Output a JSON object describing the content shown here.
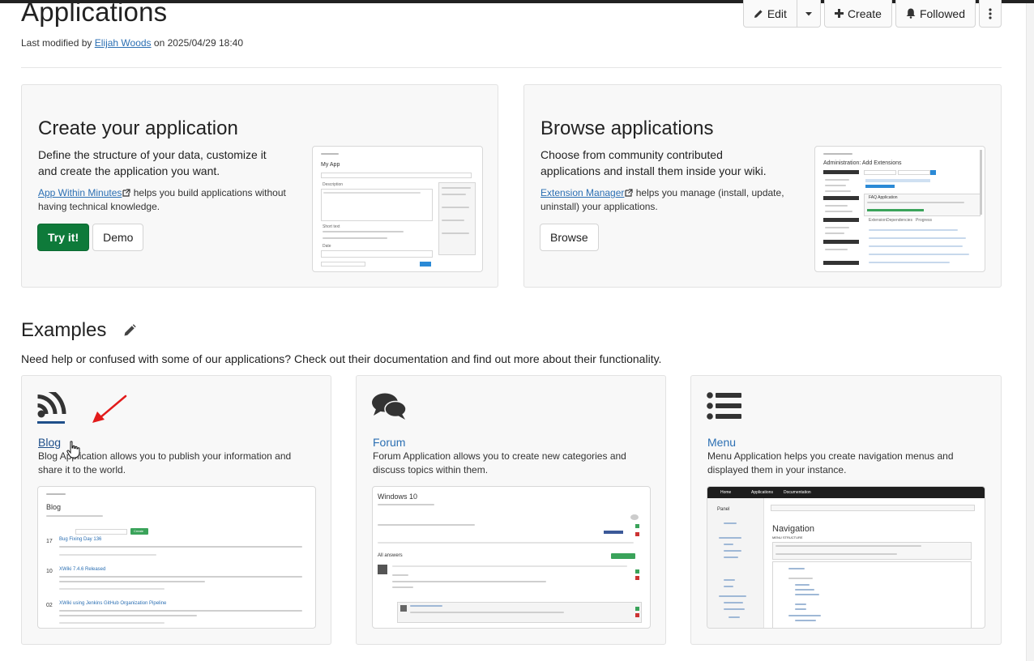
{
  "page": {
    "title": "Applications",
    "modified_prefix": "Last modified by",
    "modified_user": "Elijah Woods",
    "modified_suffix": "on 2025/04/29 18:40"
  },
  "actions": {
    "edit_label": "Edit",
    "create_label": "Create",
    "followed_label": "Followed"
  },
  "create_panel": {
    "title": "Create your application",
    "description": "Define the structure of your data, customize it and create the application you want.",
    "link_label": "App Within Minutes",
    "link_suffix": " helps you build applications without having technical knowledge.",
    "try_label": "Try it!",
    "demo_label": "Demo",
    "shot": {
      "title": "My App",
      "item1": "Description",
      "item2": "Short text",
      "item3": "Date",
      "item4": "Save & View"
    }
  },
  "browse_panel": {
    "title": "Browse applications",
    "description": "Choose from community contributed applications and install them inside your wiki.",
    "link_label": "Extension Manager",
    "link_suffix": " helps you manage (install, update, uninstall) your applications.",
    "browse_label": "Browse",
    "shot": {
      "title": "Administration: Add Extensions",
      "entry": "FAQ Application",
      "tab1": "Extension",
      "tab2": "Dependencies",
      "tab3": "Progress"
    }
  },
  "examples": {
    "title": "Examples",
    "description": "Need help or confused with some of our applications? Check out their documentation and find out more about their functionality.",
    "cards": [
      {
        "name": "Blog",
        "description": "Blog Application allows you to publish your information and share it to the world.",
        "shot": {
          "title": "Blog",
          "post1": "Bug Fixing Day 136",
          "post2": "XWiki 7.4.6 Released",
          "post3": "XWiki using Jenkins GitHub Organization Pipeline",
          "date1": "17",
          "date2": "10",
          "date3": "02",
          "create_label": "Create"
        }
      },
      {
        "name": "Forum",
        "description": "Forum Application allows you to create new categories and discuss topics within them.",
        "shot": {
          "title": "Windows 10",
          "answers": "All answers"
        }
      },
      {
        "name": "Menu",
        "description": "Menu Application helps you create navigation menus and displayed them in your instance.",
        "shot": {
          "title": "Navigation",
          "nav1": "Home",
          "nav2": "Applications",
          "nav3": "Documentation",
          "panel": "Panel",
          "structure": "MENU STRUCTURE"
        }
      }
    ]
  }
}
